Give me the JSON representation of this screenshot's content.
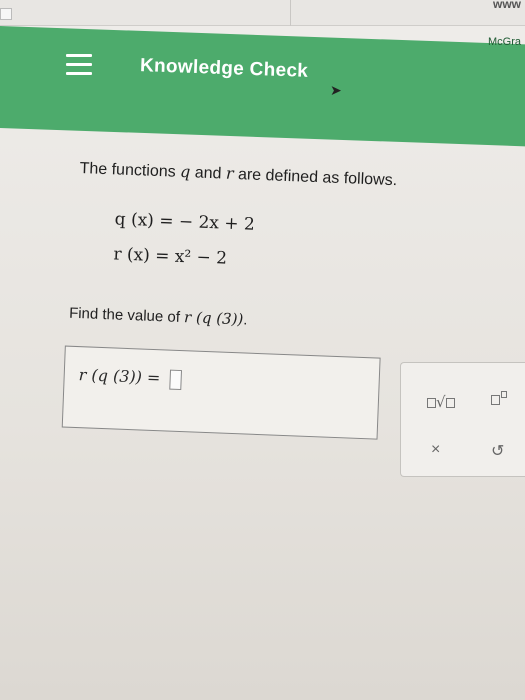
{
  "topbar": {
    "url_fragment": "www"
  },
  "header": {
    "brand": "McGra",
    "title": "Knowledge Check"
  },
  "question": {
    "prompt_pre": "The functions ",
    "q": "q",
    "and": " and ",
    "r": "r",
    "prompt_post": " are defined as follows.",
    "fn1": "q (x) = − 2x + 2",
    "fn2": "r (x) = x² − 2",
    "find_pre": "Find the value of ",
    "find_expr": "r (q (3))",
    "find_post": "."
  },
  "answer": {
    "lhs": "r (q (3)) ="
  },
  "tools": {
    "sqrt_label": "□√□",
    "power_label": "□",
    "clear_label": "×",
    "undo_label": "↺"
  },
  "colors": {
    "header_green": "#4dab6c",
    "text": "#1f1f1f"
  }
}
